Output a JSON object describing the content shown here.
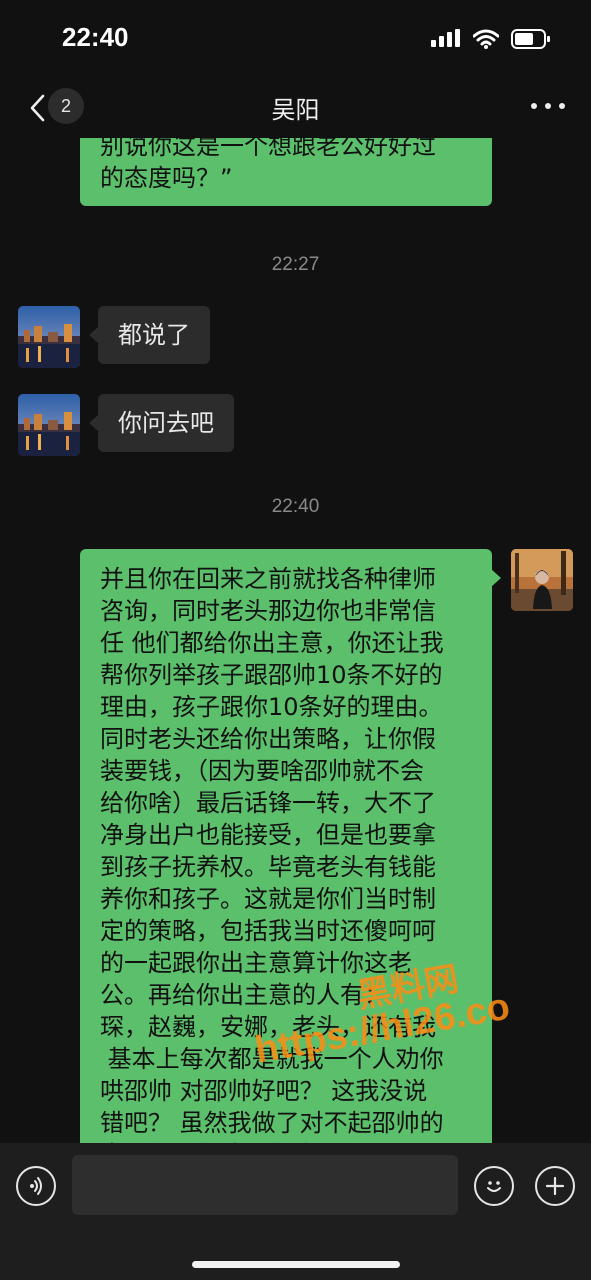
{
  "status": {
    "time": "22:40"
  },
  "nav": {
    "badge": "2",
    "title": "吴阳"
  },
  "messages": {
    "m1": "别说你这是一个想跟老公好好过\n的态度吗？”",
    "ts1": "22:27",
    "m2": "都说了",
    "m3": "你问去吧",
    "ts2": "22:40",
    "m4": "并且你在回来之前就找各种律师\n咨询，同时老头那边你也非常信\n任 他们都给你出主意，你还让我\n帮你列举孩子跟邵帅10条不好的\n理由，孩子跟你10条好的理由。\n同时老头还给你出策略，让你假\n装要钱，（因为要啥邵帅就不会\n给你啥）最后话锋一转，大不了\n净身出户也能接受，但是也要拿\n到孩子抚养权。毕竟老头有钱能\n养你和孩子。这就是你们当时制\n定的策略，包括我当时还傻呵呵\n的一起跟你出主意算计你这老\n公。再给你出主意的人有：\n琛，赵巍，安娜，老头，还有我\n 基本上每次都是就我一个人劝你\n哄邵帅 对邵帅好吧？ 这我没说\n错吧？ 虽然我做了对不起邵帅的\n事，但是有波罗有我一个人那么"
  },
  "watermark": {
    "title": "黑料网",
    "url": "https://hl26.co"
  },
  "input": {
    "placeholder": ""
  },
  "colors": {
    "bubble_me": "#5bbf6b",
    "bubble_other": "#2c2c2c",
    "background": "#111111"
  }
}
